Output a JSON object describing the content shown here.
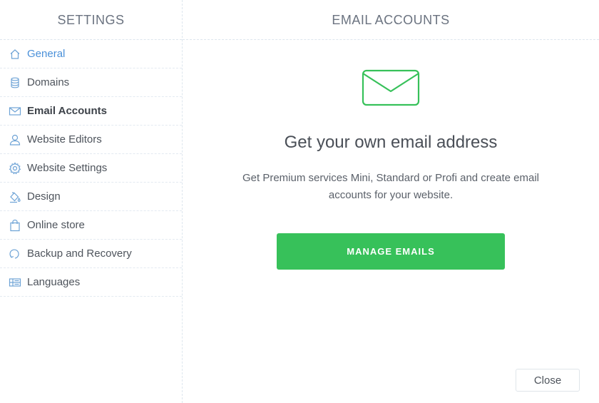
{
  "sidebar": {
    "title": "SETTINGS",
    "items": [
      {
        "label": "General",
        "icon": "home-icon"
      },
      {
        "label": "Domains",
        "icon": "database-icon"
      },
      {
        "label": "Email Accounts",
        "icon": "envelope-icon"
      },
      {
        "label": "Website Editors",
        "icon": "user-icon"
      },
      {
        "label": "Website Settings",
        "icon": "gear-icon"
      },
      {
        "label": "Design",
        "icon": "paint-bucket-icon"
      },
      {
        "label": "Online store",
        "icon": "shopping-bag-icon"
      },
      {
        "label": "Backup and Recovery",
        "icon": "restore-icon"
      },
      {
        "label": "Languages",
        "icon": "languages-icon"
      }
    ],
    "selected": "Email Accounts",
    "link_color": "#4a90d9"
  },
  "main": {
    "title": "EMAIL ACCOUNTS",
    "icon": "envelope-icon",
    "headline": "Get your own email address",
    "description": "Get Premium services Mini, Standard or Profi and create email accounts for your website.",
    "manage_button": "MANAGE EMAILS",
    "close_button": "Close"
  },
  "colors": {
    "accent_green": "#37c15a",
    "icon_blue": "#6ea3d6"
  }
}
